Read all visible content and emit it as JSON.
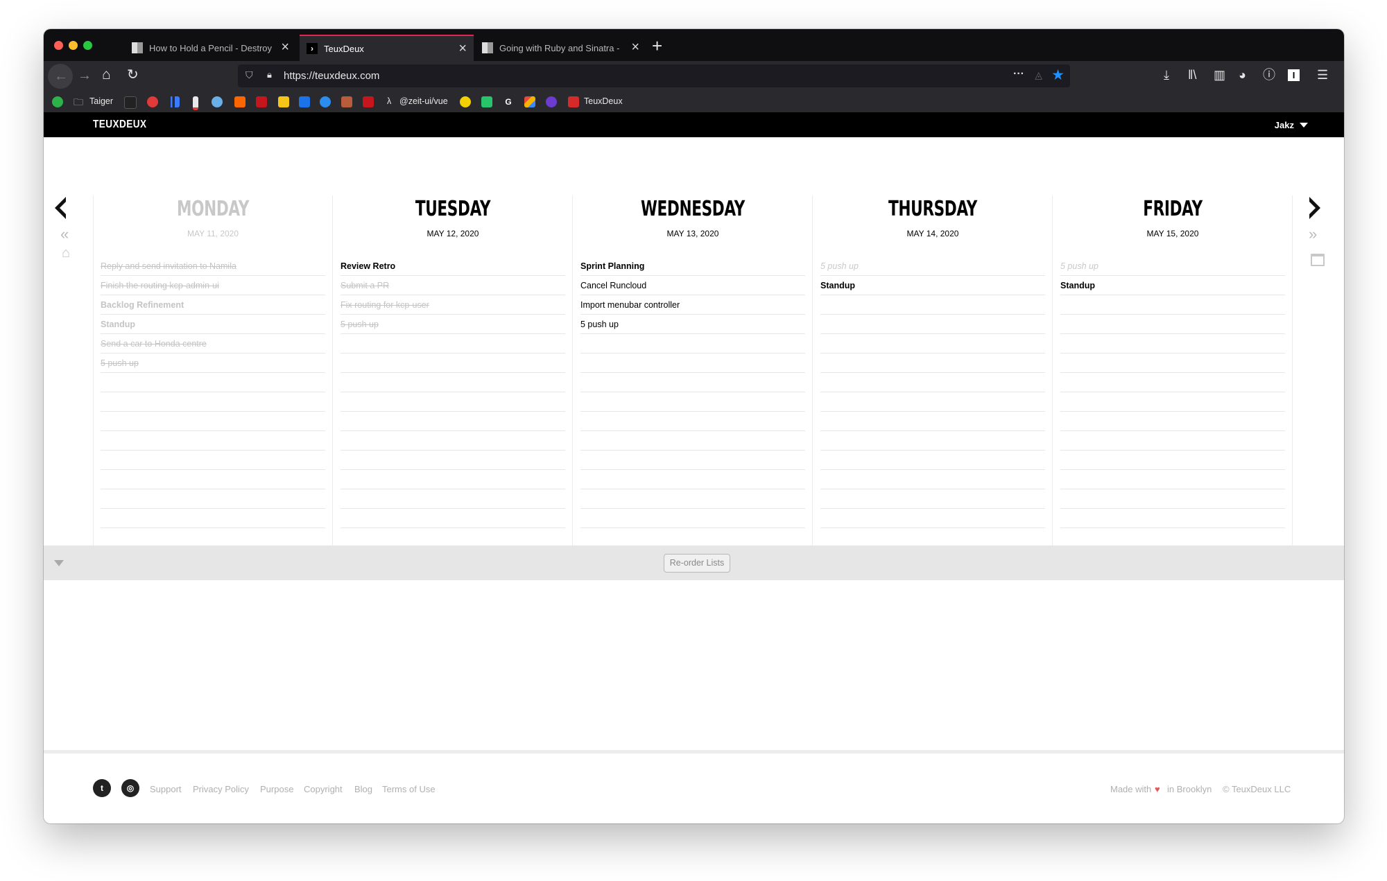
{
  "browser": {
    "tabs": [
      {
        "title": "How to Hold a Pencil - Destroy"
      },
      {
        "title": "TeuxDeux"
      },
      {
        "title": "Going with Ruby and Sinatra - "
      }
    ],
    "url": "https://teuxdeux.com",
    "bookmarks": [
      {
        "label": "Taiger"
      },
      {
        "label": "@zeit-ui/vue"
      },
      {
        "label": "TeuxDeux"
      }
    ]
  },
  "app": {
    "logo": "TEUXDEUX",
    "user": "Jakz"
  },
  "days": [
    {
      "name": "MONDAY",
      "date": "MAY 11, 2020",
      "past": true,
      "items": [
        {
          "text": "Reply and send invitation to Namila",
          "style": "done"
        },
        {
          "text": "Finish the routing kcp-admin-ui",
          "style": "done"
        },
        {
          "text": "Backlog Refinement",
          "style": "bold"
        },
        {
          "text": "Standup",
          "style": "bold"
        },
        {
          "text": "Send a car to Honda centre",
          "style": "done"
        },
        {
          "text": "5 push up",
          "style": "done"
        }
      ]
    },
    {
      "name": "TUESDAY",
      "date": "MAY 12, 2020",
      "past": false,
      "items": [
        {
          "text": "Review Retro",
          "style": "bold"
        },
        {
          "text": "Submit a PR",
          "style": "done"
        },
        {
          "text": "Fix routing for kcp-user",
          "style": "done"
        },
        {
          "text": "5 push up",
          "style": "done"
        }
      ]
    },
    {
      "name": "WEDNESDAY",
      "date": "MAY 13, 2020",
      "past": false,
      "items": [
        {
          "text": "Sprint Planning",
          "style": "bold"
        },
        {
          "text": "Cancel Runcloud",
          "style": "normal"
        },
        {
          "text": "Import menubar controller",
          "style": "normal"
        },
        {
          "text": "5 push up",
          "style": "normal"
        }
      ]
    },
    {
      "name": "THURSDAY",
      "date": "MAY 14, 2020",
      "past": false,
      "items": [
        {
          "text": "5 push up",
          "style": "faded"
        },
        {
          "text": "Standup",
          "style": "bold"
        }
      ]
    },
    {
      "name": "FRIDAY",
      "date": "MAY 15, 2020",
      "past": false,
      "items": [
        {
          "text": "5 push up",
          "style": "faded"
        },
        {
          "text": "Standup",
          "style": "bold"
        }
      ]
    }
  ],
  "reorder": {
    "label": "Re-order Lists"
  },
  "footer": {
    "links": [
      "Support",
      "Privacy Policy",
      "Purpose",
      "Copyright",
      "Blog",
      "Terms of Use"
    ],
    "made_prefix": "Made with",
    "made_suffix": "in Brooklyn",
    "copyright": "© TeuxDeux LLC"
  },
  "colors": {
    "accent_tab": "#e22850",
    "heart": "#e05a5a"
  }
}
